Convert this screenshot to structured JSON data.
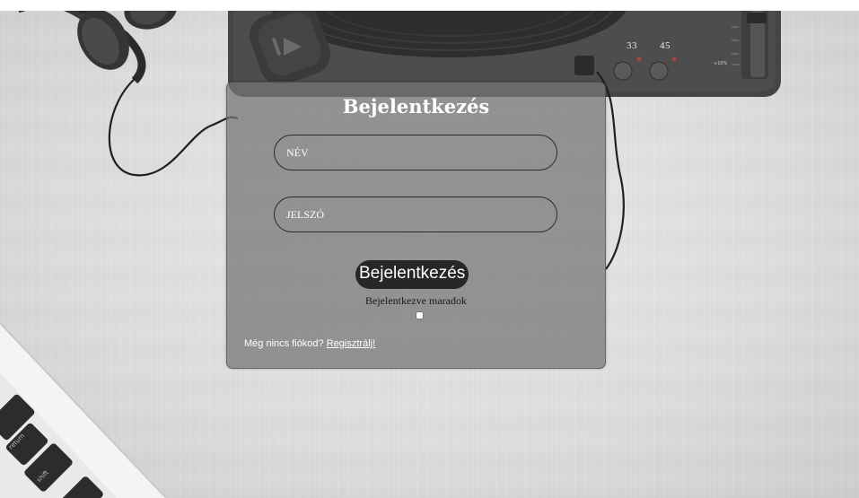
{
  "background": {
    "scene": "desk with headphones, turntable and laptop",
    "turntable": {
      "speed_33": "33",
      "speed_45": "45",
      "pitch_label": "+10%"
    },
    "laptop_keys": {
      "return_label": "return",
      "shift_label": "shift"
    }
  },
  "login": {
    "title": "Bejelentkezés",
    "name_placeholder": "NÉV",
    "password_placeholder": "JELSZÓ",
    "submit_label": "Bejelentkezés",
    "remember_label": "Bejelentkezve maradok",
    "remember_checked": false,
    "no_account_text": "Még nincs fiókod?",
    "register_link": "Regisztrálj!"
  },
  "colors": {
    "card_background": "#767676",
    "button_background": "#272727",
    "text_white": "#ffffff",
    "text_dark": "#1a1a1a"
  }
}
